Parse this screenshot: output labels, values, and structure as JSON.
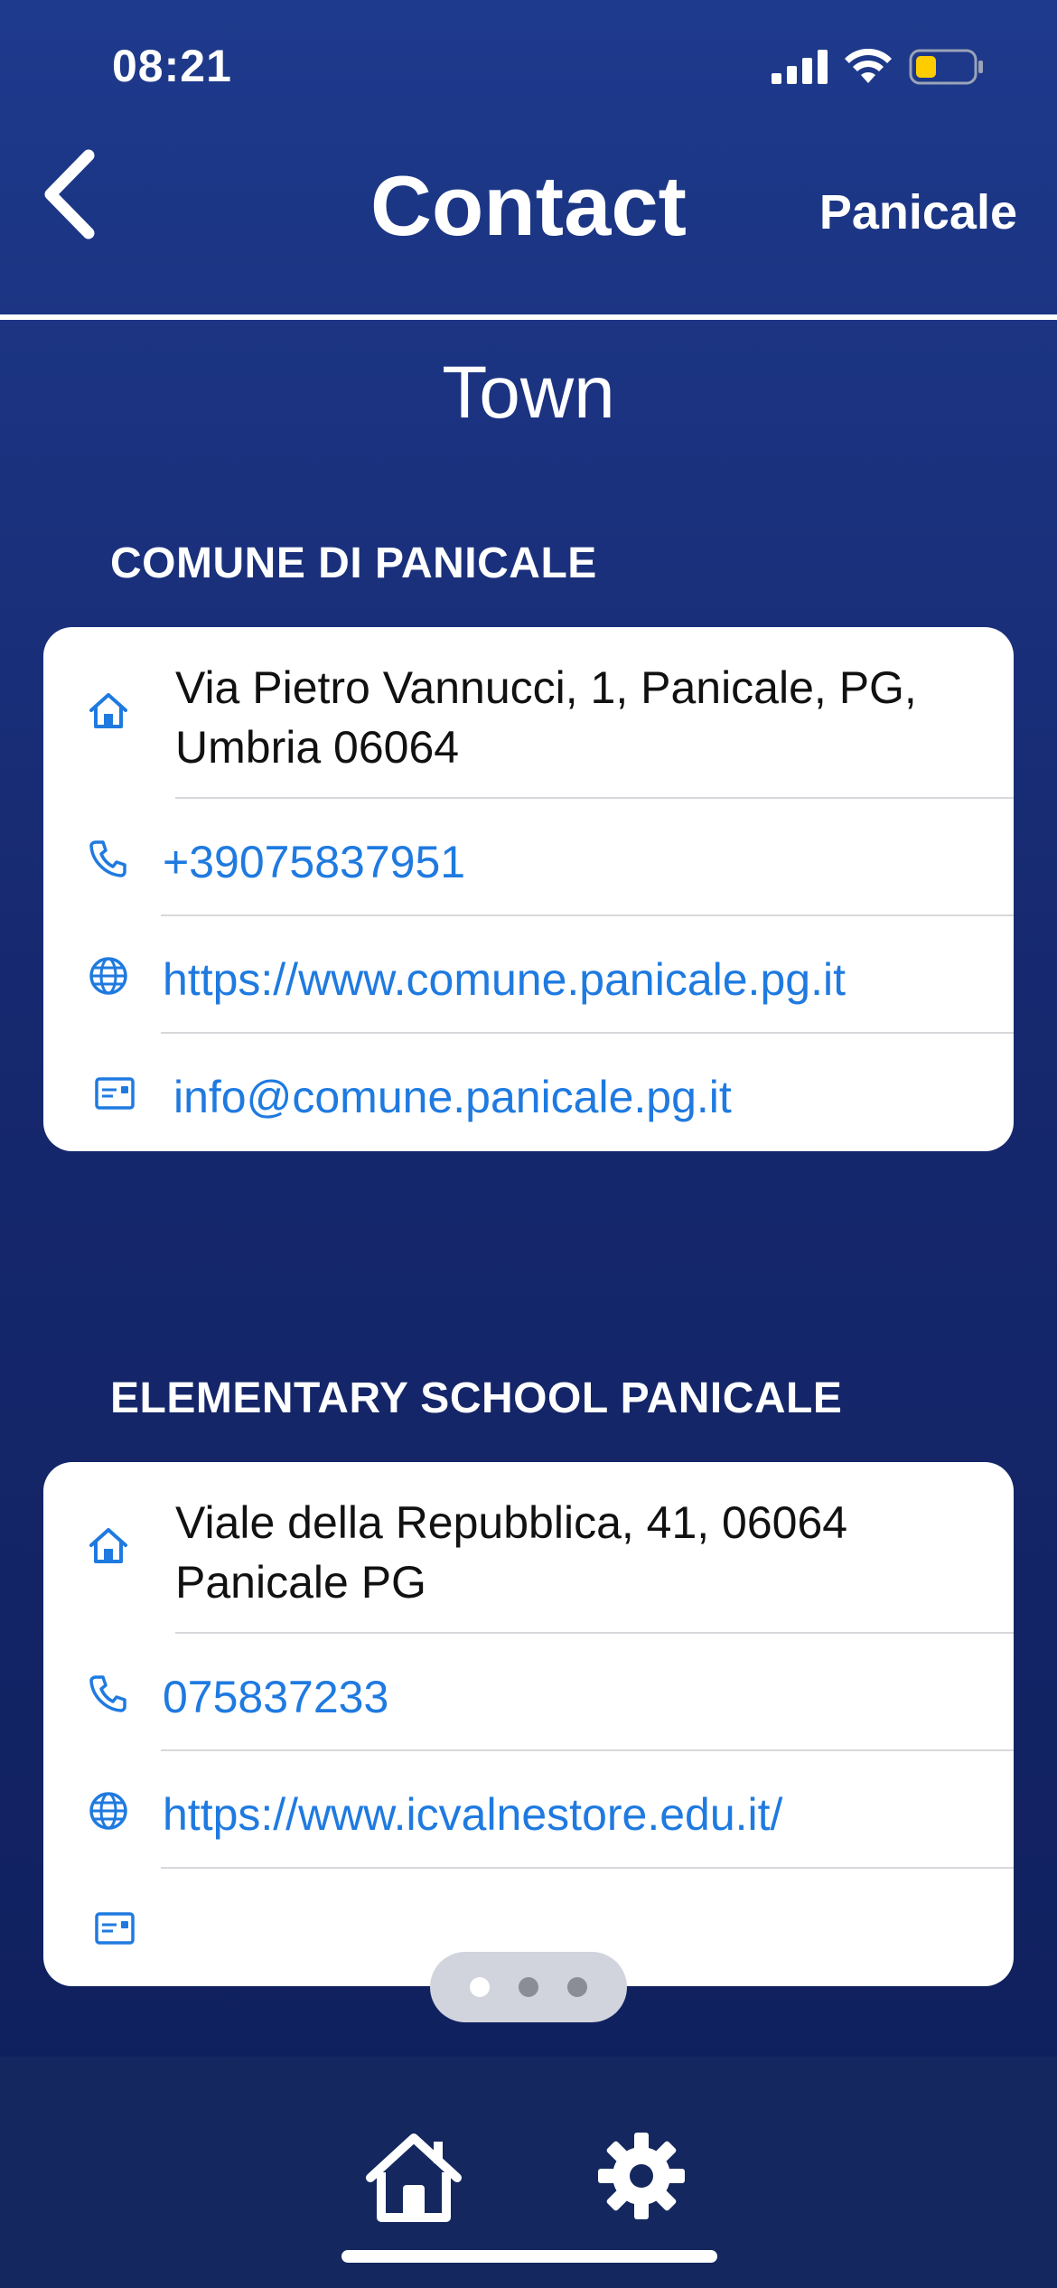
{
  "status_bar": {
    "time": "08:21"
  },
  "nav": {
    "title": "Contact",
    "right_label": "Panicale"
  },
  "subtitle": "Town",
  "sections": [
    {
      "header": "COMUNE DI PANICALE",
      "address_line1": "Via Pietro Vannucci, 1, Panicale, PG,",
      "address_line2": "Umbria 06064",
      "phone": "+39075837951",
      "website": "https://www.comune.panicale.pg.it",
      "email": "info@comune.panicale.pg.it"
    },
    {
      "header": "ELEMENTARY SCHOOL PANICALE",
      "address_line1": "Viale della Repubblica, 41, 06064",
      "address_line2": "Panicale PG",
      "phone": "075837233",
      "website": "https://www.icvalnestore.edu.it/",
      "email": ""
    }
  ],
  "pager": {
    "count": 3,
    "active_index": 0
  },
  "icons": {
    "address": "house-icon",
    "phone": "phone-icon",
    "website": "globe-icon",
    "email": "contact-card-icon"
  },
  "colors": {
    "accent": "#1f7ae0",
    "background": "#1a3378",
    "battery": "#ffcc00"
  }
}
